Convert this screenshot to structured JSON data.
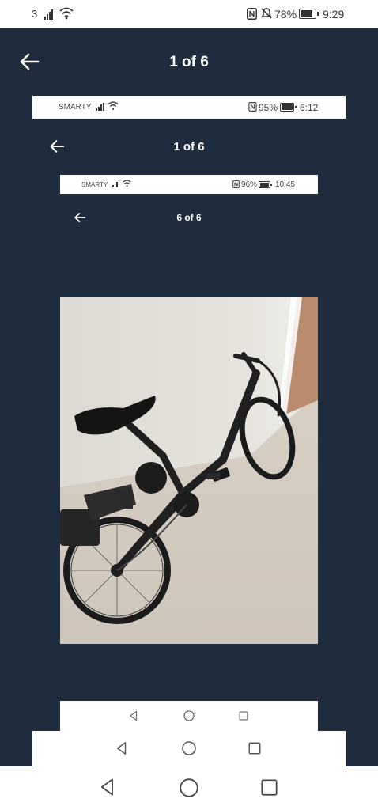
{
  "status_bar": {
    "carrier": "3",
    "battery": "78%",
    "time": "9:29"
  },
  "viewer": {
    "title": "1 of 6"
  },
  "nested1": {
    "carrier": "SMARTY",
    "battery": "95%",
    "time": "6:12",
    "title": "1 of 6"
  },
  "nested2": {
    "carrier": "SMARTY",
    "battery": "96%",
    "time": "10:45",
    "title": "6 of 6"
  },
  "colors": {
    "panel_bg": "#1f2c3d",
    "text_light": "#ffffff"
  },
  "icons": [
    "back-arrow-icon",
    "signal-icon",
    "wifi-icon",
    "nfc-icon",
    "mute-icon",
    "battery-icon",
    "nav-back-icon",
    "nav-home-icon",
    "nav-recents-icon"
  ]
}
